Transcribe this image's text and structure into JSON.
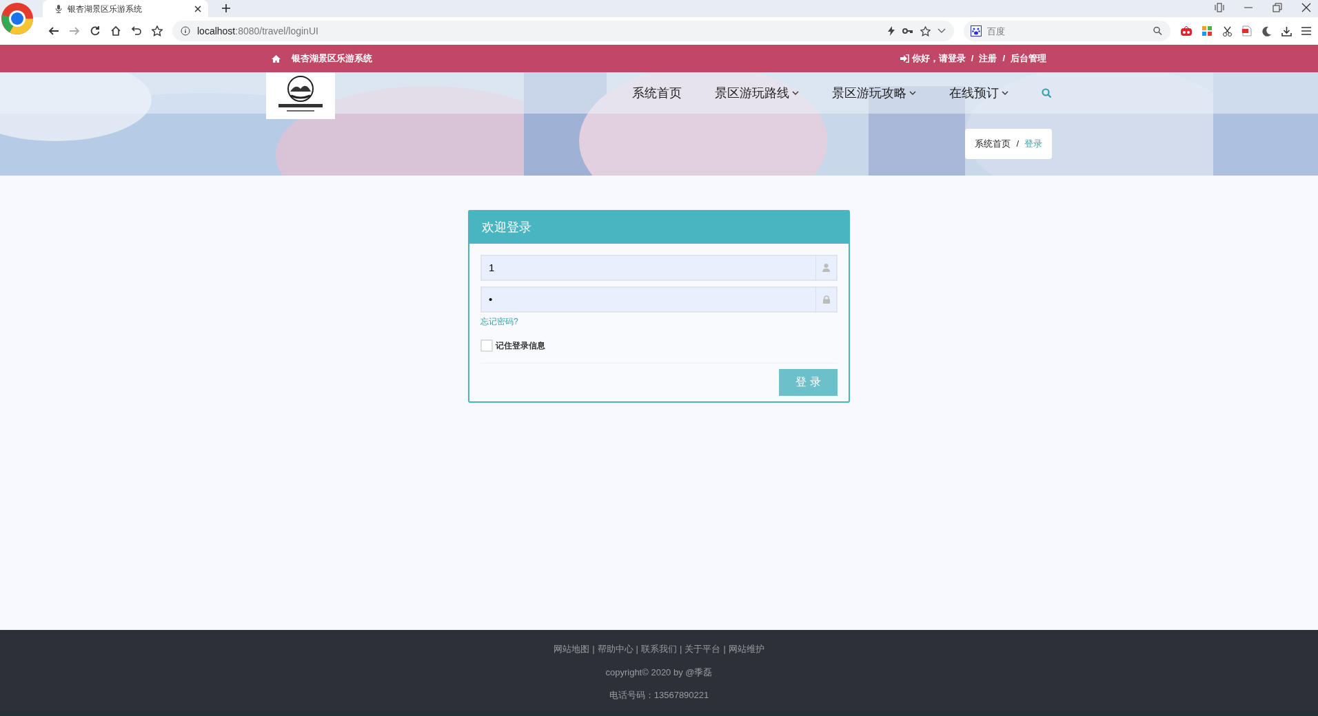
{
  "browser": {
    "tab_title": "银杏湖景区乐游系统",
    "url_host": "localhost",
    "url_rest": ":8080/travel/loginUI",
    "search_placeholder": "百度"
  },
  "topbar": {
    "site_name": "银杏湖景区乐游系统",
    "user_links": [
      {
        "label": "你好，请登录"
      },
      {
        "separator": "/",
        "label": "注册"
      },
      {
        "separator": "/",
        "label": "后台管理"
      }
    ]
  },
  "nav": {
    "items": [
      {
        "label": "系统首页",
        "dropdown": false
      },
      {
        "label": "景区游玩路线",
        "dropdown": true
      },
      {
        "label": "景区游玩攻略",
        "dropdown": true
      },
      {
        "label": "在线预订",
        "dropdown": true
      }
    ]
  },
  "breadcrumb": [
    {
      "label": "系统首页",
      "selected": false
    },
    {
      "separator": "/",
      "label": "登录",
      "selected": true
    }
  ],
  "login": {
    "title": "欢迎登录",
    "username": {
      "value": "1"
    },
    "password": {
      "value": "•"
    },
    "forgot_link": "忘记密码?",
    "remember": {
      "label": "记住登录信息",
      "checked": false
    },
    "submit": "登 录"
  },
  "footer": {
    "links": [
      {
        "label": "网站地图"
      },
      {
        "separator": "|",
        "label": "帮助中心"
      },
      {
        "separator": "|",
        "label": "联系我们"
      },
      {
        "separator": "|",
        "label": "关于平台"
      },
      {
        "separator": "|",
        "label": "网站维护"
      }
    ],
    "copyright": "copyright© 2020 by @季磊",
    "phone": "电话号码：13567890221"
  }
}
